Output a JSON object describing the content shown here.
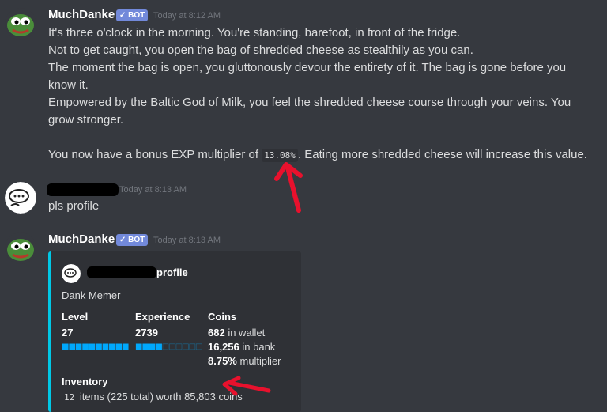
{
  "message1": {
    "username": "MuchDanke",
    "badge": "✓ BOT",
    "timestamp": "Today at 8:12 AM",
    "lines": [
      "It's three o'clock in the morning. You're standing, barefoot, in front of the fridge.",
      "Not to get caught, you open the bag of shredded cheese as stealthily as you can.",
      "The moment the bag is open, you gluttonously devour the entirety of it. The bag is gone before you",
      "know it.",
      "Empowered by the Baltic God of Milk, you feel the shredded cheese course through your veins. You",
      "grow stronger."
    ],
    "exp_prefix": "You now have a bonus EXP multiplier of ",
    "exp_value": "13.08%",
    "exp_suffix": ". Eating more shredded cheese will increase this value."
  },
  "message2": {
    "timestamp": "Today at 8:13 AM",
    "text": "pls profile"
  },
  "message3": {
    "username": "MuchDanke",
    "badge": "✓ BOT",
    "timestamp": "Today at 8:13 AM",
    "embed": {
      "author_suffix": "profile",
      "description": "Dank Memer",
      "fields": {
        "level": {
          "name": "Level",
          "value": "27",
          "progress": 1.0
        },
        "experience": {
          "name": "Experience",
          "value": "2739",
          "progress": 0.4
        },
        "coins": {
          "name": "Coins",
          "wallet_amount": "682",
          "wallet_label": " in wallet",
          "bank_amount": "16,256",
          "bank_label": " in bank",
          "multiplier_amount": "8.75%",
          "multiplier_label": " multiplier"
        },
        "inventory": {
          "name": "Inventory",
          "count": "12",
          "text": " items (225 total) worth 85,803 coins"
        }
      }
    }
  },
  "colors": {
    "background": "#36393f",
    "embed_bg": "#2f3136",
    "embed_accent": "#00c8e6",
    "bot_badge": "#7289da",
    "annotation_red": "#e8112d"
  }
}
